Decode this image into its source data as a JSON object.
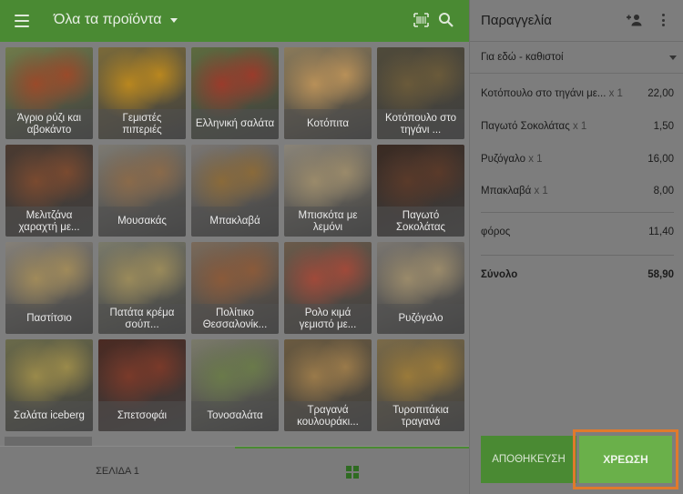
{
  "topbar": {
    "category_title": "Όλα τα προϊόντα",
    "accent": "#4a8a33"
  },
  "products": [
    {
      "label": "Άγριο ρύζι και αβοκάντο",
      "bg": "#6f7a4a",
      "accent": "#9a4a2a"
    },
    {
      "label": "Γεμιστές πιπεριές",
      "bg": "#7a6a3a",
      "accent": "#b9871f"
    },
    {
      "label": "Ελληνική σαλάτα",
      "bg": "#5d6b3f",
      "accent": "#9a3b2b"
    },
    {
      "label": "Κοτόπιτα",
      "bg": "#8a7a5a",
      "accent": "#b89058"
    },
    {
      "label": "Κοτόπουλο στο τηγάνι ...",
      "bg": "#4f4a3a",
      "accent": "#6a5a3a"
    },
    {
      "label": "Μελιτζάνα χαραχτή με...",
      "bg": "#4a3a30",
      "accent": "#7a4a30"
    },
    {
      "label": "Μουσακάς",
      "bg": "#7d7a72",
      "accent": "#8a6a4a"
    },
    {
      "label": "Μπακλαβά",
      "bg": "#7a7672",
      "accent": "#8a6a3a"
    },
    {
      "label": "Μπισκότα με λεμόνι",
      "bg": "#8a8478",
      "accent": "#9a8a6a"
    },
    {
      "label": "Παγωτό Σοκολάτας",
      "bg": "#3a2a22",
      "accent": "#5a3a2a"
    },
    {
      "label": "Παστίτσιο",
      "bg": "#858078",
      "accent": "#a08a5a"
    },
    {
      "label": "Πατάτα κρέμα σούπ...",
      "bg": "#7a7a6a",
      "accent": "#9a8a5a"
    },
    {
      "label": "Πολίτικο Θεσσαλονίκ...",
      "bg": "#7a6a5a",
      "accent": "#8a5a3a"
    },
    {
      "label": "Ρολο κιμά γεμιστό με...",
      "bg": "#6a5a4a",
      "accent": "#a04a3a"
    },
    {
      "label": "Ρυζόγαλο",
      "bg": "#7a7670",
      "accent": "#9a8a6a"
    },
    {
      "label": "Σαλάτα iceberg",
      "bg": "#6a6a4a",
      "accent": "#9a8a4a"
    },
    {
      "label": "Σπετσοφάι",
      "bg": "#4a2a22",
      "accent": "#7a3a2a"
    },
    {
      "label": "Τονοσαλάτα",
      "bg": "#7a7a6a",
      "accent": "#6a7a4a"
    },
    {
      "label": "Τραγανά κουλουράκι...",
      "bg": "#6a5a40",
      "accent": "#9a7a4a"
    },
    {
      "label": "Τυροπιτάκια τραγανά",
      "bg": "#7a6a48",
      "accent": "#9a7a3a"
    }
  ],
  "bottombar": {
    "page_label": "ΣΕΛΙΔΑ 1"
  },
  "order": {
    "title": "Παραγγελία",
    "dine_option": "Για εδώ - καθιστοί",
    "items": [
      {
        "name": "Κοτόπουλο στο τηγάνι με...",
        "qty": "x 1",
        "price": "22,00"
      },
      {
        "name": "Παγωτό Σοκολάτας",
        "qty": "x 1",
        "price": "1,50"
      },
      {
        "name": "Ρυζόγαλο",
        "qty": "x 1",
        "price": "16,00"
      },
      {
        "name": "Μπακλαβά",
        "qty": "x 1",
        "price": "8,00"
      }
    ],
    "tax_label": "φόρος",
    "tax_value": "11,40",
    "total_label": "Σύνολο",
    "total_value": "58,90",
    "save_label": "ΑΠΟΘΗΚΕΥΣΗ",
    "charge_label": "ΧΡΕΩΣΗ",
    "highlight_color": "#e07a2c"
  }
}
